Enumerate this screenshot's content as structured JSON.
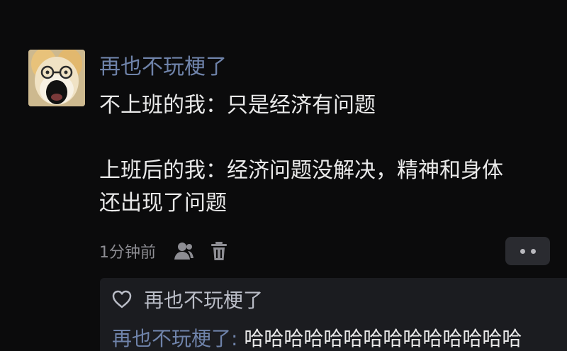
{
  "comment": {
    "avatar_icon": "dog-with-glasses-avatar",
    "username": "再也不玩梗了",
    "body_lines": [
      "不上班的我：只是经济有问题",
      "上班后的我：经济问题没解决，精神和身体",
      "还出现了问题"
    ],
    "timestamp": "1分钟前",
    "user_icon": "person-icon",
    "delete_icon": "trash-icon",
    "more_icon": "two-dots-icon"
  },
  "likes": {
    "icon": "heart-outline-icon",
    "names": "再也不玩梗了"
  },
  "reply": {
    "author": "再也不玩梗了:",
    "text": " 哈哈哈哈哈哈哈哈哈哈哈哈哈哈"
  },
  "colors": {
    "background": "#0b0b0c",
    "username": "#6f83aa",
    "body_text": "#e9e9e9",
    "meta_text": "#8d8d93",
    "reply_panel": "#1b1c20",
    "more_button": "#2a2b30"
  }
}
